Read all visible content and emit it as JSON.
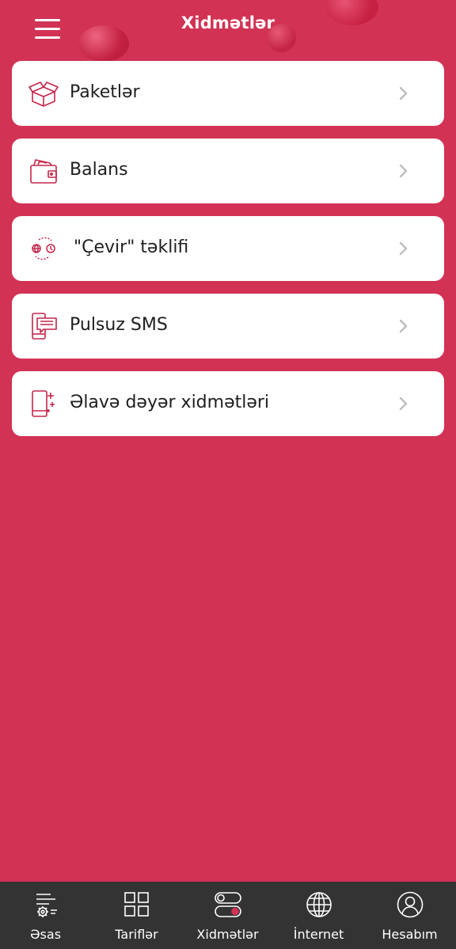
{
  "header": {
    "title": "Xidmətlər",
    "menu_icon": "hamburger-menu-icon"
  },
  "colors": {
    "background": "#d23254",
    "accent": "#d23254",
    "tabbar": "#333333",
    "card": "#ffffff"
  },
  "services": [
    {
      "label": "Paketlər",
      "icon": "box-icon"
    },
    {
      "label": "Balans",
      "icon": "wallet-icon"
    },
    {
      "label": "\"Çevir\" təklifi",
      "icon": "convert-icon"
    },
    {
      "label": "Pulsuz SMS",
      "icon": "sms-icon"
    },
    {
      "label": "Əlavə dəyər xidmətləri",
      "icon": "phone-plus-icon"
    }
  ],
  "tabbar": [
    {
      "label": "Əsas",
      "icon": "home-settings-icon"
    },
    {
      "label": "Tariflər",
      "icon": "grid-icon"
    },
    {
      "label": "Xidmətlər",
      "icon": "toggle-icon"
    },
    {
      "label": "İnternet",
      "icon": "globe-icon"
    },
    {
      "label": "Hesabım",
      "icon": "user-icon"
    }
  ]
}
